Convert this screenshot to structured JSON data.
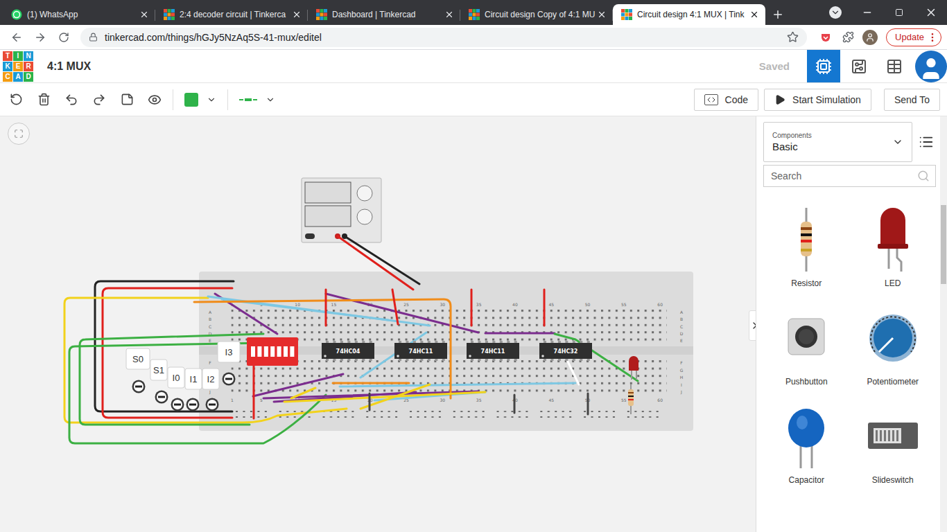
{
  "browser": {
    "tabs": [
      {
        "label": "(1) WhatsApp",
        "kind": "whatsapp",
        "selected": false
      },
      {
        "label": "2:4 decoder circuit | Tinkerca",
        "kind": "tinkercad",
        "selected": false
      },
      {
        "label": "Dashboard | Tinkercad",
        "kind": "tinkercad",
        "selected": false
      },
      {
        "label": "Circuit design Copy of 4:1 MU",
        "kind": "tinkercad",
        "selected": false
      },
      {
        "label": "Circuit design 4:1 MUX | Tink",
        "kind": "tinkercad",
        "selected": true
      }
    ],
    "address": "tinkercad.com/things/hGJy5NzAq5S-41-mux/editel",
    "bookmarked": false,
    "update_button": "Update"
  },
  "app": {
    "logo": [
      "T",
      "I",
      "N",
      "K",
      "E",
      "R",
      "C",
      "A",
      "D"
    ],
    "title": "4:1 MUX",
    "save_status": "Saved",
    "views": [
      {
        "name": "circuit",
        "selected": true
      },
      {
        "name": "schematic",
        "selected": false
      },
      {
        "name": "component-list",
        "selected": false
      }
    ]
  },
  "toolbar": {
    "wire_color": "#2fb34a",
    "buttons": [
      {
        "label": "Code",
        "kind": "code"
      },
      {
        "label": "Start Simulation",
        "kind": "simulate"
      },
      {
        "label": "Send To",
        "kind": "plain"
      }
    ]
  },
  "canvas": {
    "breadboard": {
      "columns": [
        "1",
        "5",
        "10",
        "15",
        "20",
        "25",
        "30",
        "35",
        "40",
        "45",
        "50",
        "55",
        "60"
      ],
      "rows": [
        "A",
        "B",
        "C",
        "D",
        "E",
        "F",
        "G",
        "H",
        "I",
        "J"
      ]
    },
    "chips": [
      "74HC04",
      "74HC11",
      "74HC11",
      "74HC32"
    ],
    "labels": [
      "S0",
      "S1",
      "I0",
      "I1",
      "I2",
      "I3"
    ]
  },
  "panel": {
    "category_label": "Components",
    "category": "Basic",
    "search_placeholder": "Search",
    "items": [
      {
        "label": "Resistor",
        "kind": "resistor"
      },
      {
        "label": "LED",
        "kind": "led"
      },
      {
        "label": "Pushbutton",
        "kind": "pushbutton"
      },
      {
        "label": "Potentiometer",
        "kind": "potentiometer"
      },
      {
        "label": "Capacitor",
        "kind": "capacitor"
      },
      {
        "label": "Slideswitch",
        "kind": "slideswitch"
      }
    ]
  }
}
